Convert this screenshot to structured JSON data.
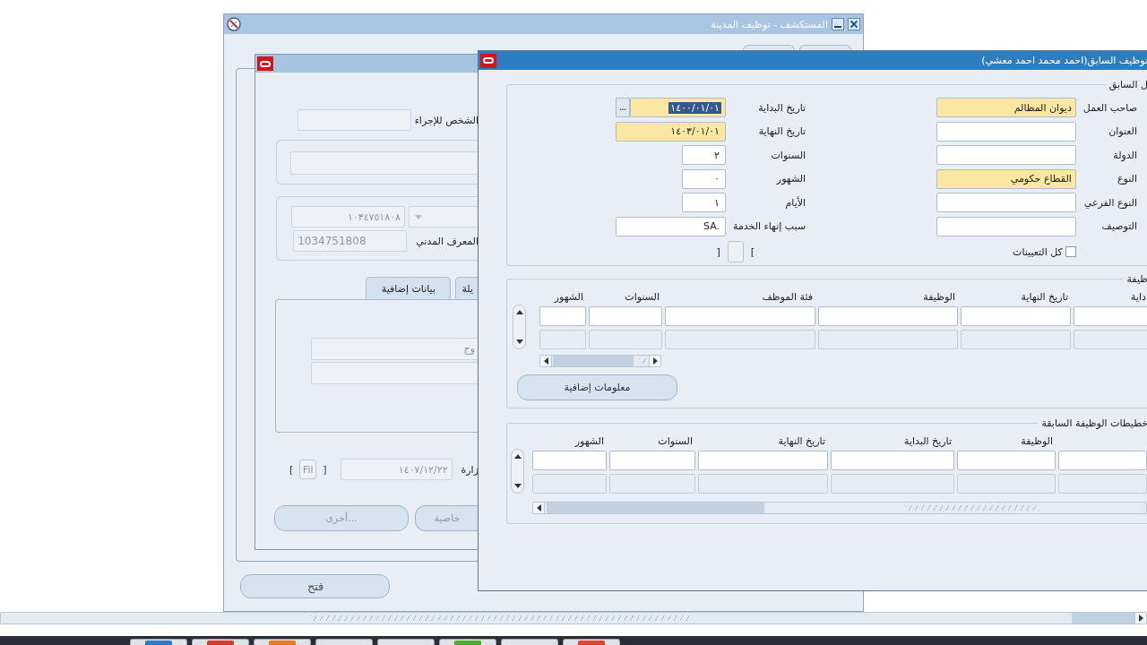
{
  "explorer_window": {
    "title": "المستكشف - توظيف المدينة",
    "open_button": "فتح"
  },
  "person_window": {
    "action_person": {
      "label": "الشخص للإجراء"
    },
    "civil_id": {
      "arabic_value": "١٠٣٤٧٥١٨٠٨",
      "value": "1034751808",
      "label": "المعرف المدني"
    },
    "tabs": [
      {
        "label": "يلة"
      },
      {
        "label": "بيانات إضافية"
      }
    ],
    "panel_field": {
      "value": "وج"
    },
    "decision": {
      "label": "زارة",
      "value": "١٤٠٧/١٢/٢٢",
      "attachment_open": "[",
      "attachment_button": "Fil",
      "attachment_close": "]"
    },
    "buttons": [
      {
        "label": "خاصية"
      },
      {
        "label": "أخرى..."
      }
    ]
  },
  "prior_employment_window": {
    "title": "توظيف السابق(احمد محمد احمد معشي)",
    "details": {
      "legend": "ل السابق",
      "column_1": [
        {
          "label": "صاحب العمل",
          "value": "ديوان المظالم",
          "required": true
        },
        {
          "label": "العنوان",
          "required": false
        },
        {
          "label": "الدولة",
          "required": false
        },
        {
          "label": "النوع",
          "value": "القطاع حكومي",
          "required": true
        },
        {
          "label": "النوع الفرعي",
          "required": false
        },
        {
          "label": "التوصيف",
          "required": false
        }
      ],
      "all_assignments": {
        "label": "كل التعيينات",
        "checked": false
      },
      "column_2": [
        {
          "label": "تاريخ البداية",
          "value": "١٤٠٠/٠١/٠١",
          "kind": "lov",
          "lov_button": "...",
          "required": true,
          "text_selected": true
        },
        {
          "label": "تاريخ النهاية",
          "value": "١٤٠٣/٠١/٠١",
          "kind": "text",
          "required": true,
          "text_selected": false
        },
        {
          "label": "السنوات",
          "value": "٢",
          "kind": "short",
          "required": false,
          "text_selected": false
        },
        {
          "label": "الشهور",
          "value": "٠",
          "kind": "short",
          "required": false,
          "text_selected": false
        },
        {
          "label": "الأيام",
          "value": "١",
          "kind": "short",
          "required": false,
          "text_selected": false
        },
        {
          "label": "سبب إنهاء الخدمة",
          "value": "SA.",
          "kind": "text",
          "required": false,
          "text_selected": false
        }
      ],
      "attachment": {
        "open": "[",
        "close": "]"
      }
    },
    "jobs": {
      "legend": "ظيفة",
      "columns": [
        "داية",
        "تاريخ النهاية",
        "الوظيفة",
        "فئة الموظف",
        "السنوات",
        "الشهور"
      ],
      "more_info_button": "معلومات إضافية"
    },
    "plans": {
      "legend": "خطيطات الوظيفة السابقة",
      "cut_column": true,
      "columns": [
        "الوظيفة",
        "تاريخ البداية",
        "تاريخ النهاية",
        "السنوات",
        "الشهور"
      ]
    }
  }
}
